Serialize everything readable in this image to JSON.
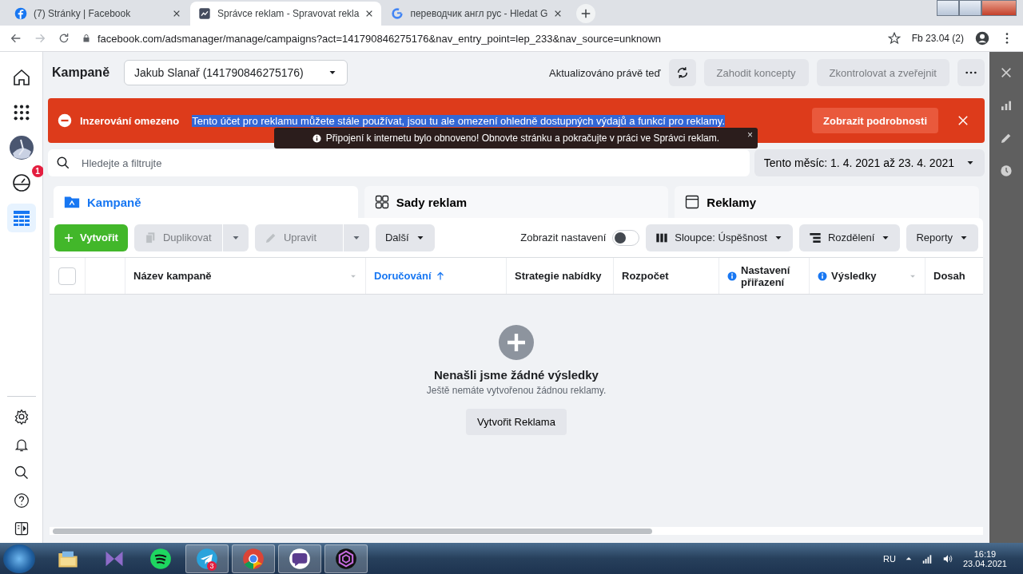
{
  "browser": {
    "tabs": [
      {
        "title": "(7) Stránky | Facebook",
        "kind": "facebook",
        "selected": false
      },
      {
        "title": "Správce reklam - Spravovat rekla",
        "kind": "ads",
        "selected": true
      },
      {
        "title": "переводчик англ рус - Hledat G",
        "kind": "google",
        "selected": false
      }
    ],
    "url": "facebook.com/adsmanager/manage/campaigns?act=141790846275176&nav_entry_point=lep_233&nav_source=unknown",
    "bookmark": "Fb 23.04 (2)"
  },
  "sidebar": {
    "items": [
      {
        "kind": "home",
        "selected": false
      },
      {
        "kind": "apps",
        "selected": false
      },
      {
        "kind": "avatar",
        "selected": false
      },
      {
        "kind": "gauge",
        "selected": false,
        "badge": "1"
      },
      {
        "kind": "table",
        "selected": true
      }
    ],
    "bottom": [
      {
        "kind": "settings"
      },
      {
        "kind": "bell"
      },
      {
        "kind": "search"
      },
      {
        "kind": "help"
      },
      {
        "kind": "panel"
      }
    ]
  },
  "header": {
    "title": "Kampaně",
    "account": "Jakub Slanař (141790846275176)",
    "status": "Aktualizováno právě teď",
    "buttons": [
      {
        "label": "Zahodit koncepty",
        "disabled": true
      },
      {
        "label": "Zkontrolovat a zveřejnit",
        "disabled": true
      }
    ]
  },
  "banner": {
    "title": "Inzerování omezeno",
    "message": "Tento účet pro reklamu můžete stále používat, jsou tu ale omezení ohledně dostupných výdajů a funkcí pro reklamy.",
    "highlighted": true,
    "button": "Zobrazit podrobnosti"
  },
  "toast": {
    "text": "Připojení k internetu bylo obnoveno! Obnovte stránku a pokračujte v práci ve Správci reklam.",
    "close": "×"
  },
  "search": {
    "placeholder": "Hledejte a filtrujte"
  },
  "date_range": "Tento měsíc: 1. 4. 2021 až 23. 4. 2021",
  "level_tabs": [
    {
      "label": "Kampaně",
      "kind": "folder",
      "selected": true
    },
    {
      "label": "Sady reklam",
      "kind": "grid",
      "selected": false
    },
    {
      "label": "Reklamy",
      "kind": "window",
      "selected": false
    }
  ],
  "toolbar": {
    "create": "Vytvořit",
    "split_buttons": [
      {
        "label": "Duplikovat",
        "kind": "copy",
        "disabled": true
      },
      {
        "label": "Upravit",
        "kind": "pencil",
        "disabled": true
      }
    ],
    "more": "Další",
    "toggle": {
      "label": "Zobrazit nastavení",
      "on": false
    },
    "menus": [
      {
        "label": "Sloupce: Úspěšnost",
        "kind": "columns"
      },
      {
        "label": "Rozdělení",
        "kind": "breakdown"
      },
      {
        "label": "Reporty",
        "kind": "plain"
      }
    ]
  },
  "table": {
    "select_all": {
      "checked": false
    },
    "columns": [
      {
        "label": "Název kampaně",
        "sorted": false,
        "info": false,
        "filter": true
      },
      {
        "label": "Doručování",
        "sorted": true,
        "info": false,
        "filter": false
      },
      {
        "label": "Strategie nabídky",
        "sorted": false,
        "info": false,
        "filter": false
      },
      {
        "label": "Rozpočet",
        "sorted": false,
        "info": false,
        "filter": false
      },
      {
        "label": "Nastavení přiřazení",
        "sorted": false,
        "info": true,
        "filter": false
      },
      {
        "label": "Výsledky",
        "sorted": false,
        "info": true,
        "filter": true
      },
      {
        "label": "Dosah",
        "sorted": false,
        "info": false,
        "filter": false
      }
    ],
    "empty": {
      "title": "Nenašli jsme žádné výsledky",
      "subtitle": "Ještě nemáte vytvořenou žádnou reklamy.",
      "button": "Vytvořit Reklama"
    }
  },
  "right_panel": [
    {
      "kind": "close"
    },
    {
      "kind": "chart"
    },
    {
      "kind": "pencil"
    },
    {
      "kind": "clock"
    }
  ],
  "taskbar": {
    "apps": [
      {
        "kind": "explorer",
        "selected": false
      },
      {
        "kind": "vs",
        "selected": false
      },
      {
        "kind": "spotify",
        "selected": false
      },
      {
        "kind": "telegram",
        "selected": true,
        "badge": "3"
      },
      {
        "kind": "chrome",
        "selected": true
      },
      {
        "kind": "viber",
        "selected": true
      },
      {
        "kind": "app",
        "selected": true
      }
    ],
    "lang": "RU",
    "time": "16:19",
    "date": "23.04.2021"
  }
}
